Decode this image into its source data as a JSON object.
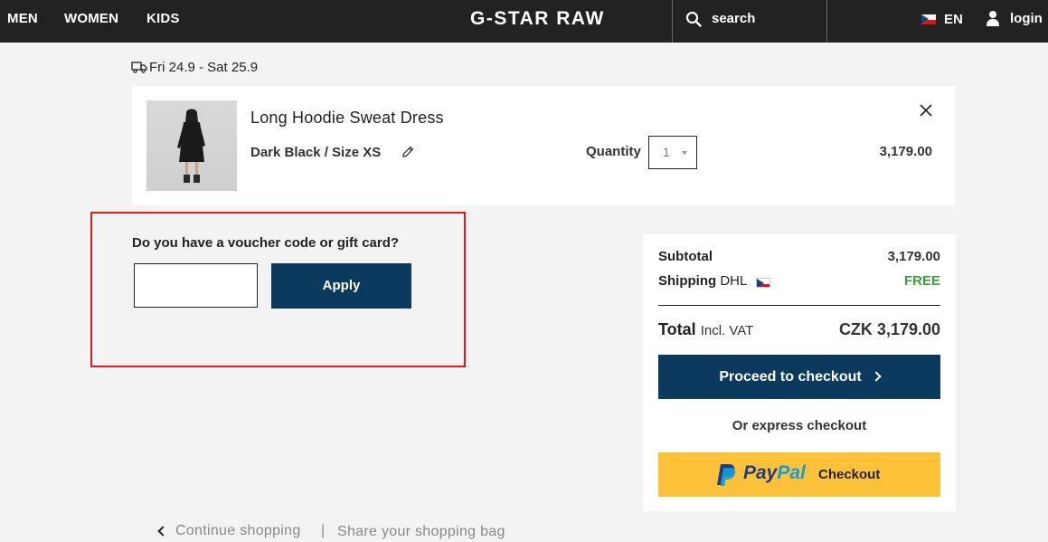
{
  "nav": {
    "links": [
      "MEN",
      "WOMEN",
      "KIDS"
    ],
    "logo": "G-STAR RAW",
    "search_label": "search",
    "language": "EN",
    "login": "login"
  },
  "delivery": {
    "dates": "Fri 24.9 - Sat 25.9"
  },
  "product": {
    "name": "Long Hoodie Sweat Dress",
    "variant": "Dark Black / Size XS",
    "quantity_label": "Quantity",
    "quantity": "1",
    "price": "3,179.00"
  },
  "voucher": {
    "title": "Do you have a voucher code or gift card?",
    "input_value": "",
    "apply_label": "Apply"
  },
  "summary": {
    "subtotal_label": "Subtotal",
    "subtotal_value": "3,179.00",
    "shipping_label": "Shipping",
    "shipping_carrier": "DHL",
    "shipping_value": "FREE",
    "total_label": "Total",
    "total_sub": "Incl. VAT",
    "total_value": "CZK 3,179.00",
    "checkout_label": "Proceed to checkout",
    "express_label": "Or express checkout",
    "paypal_pay": "Pay",
    "paypal_pal": "Pal",
    "paypal_checkout": "Checkout"
  },
  "footer": {
    "continue": "Continue shopping",
    "separator": "|",
    "share": "Share your shopping bag"
  },
  "colors": {
    "nav_bg": "#222222",
    "button_navy": "#0b3a5e",
    "paypal_yellow": "#fec23a",
    "free_green": "#3aa335",
    "highlight_red": "#e01b1b"
  }
}
